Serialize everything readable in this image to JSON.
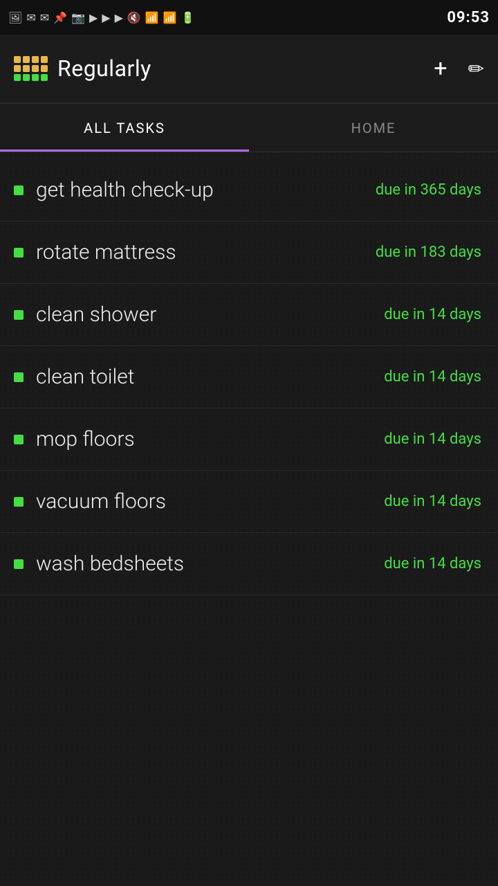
{
  "statusBar": {
    "time": "09:53",
    "icons": [
      "📷",
      "✉",
      "✉",
      "📌",
      "📷",
      "▶",
      "▶",
      "▶",
      "🔇",
      "📶",
      "📶",
      "🔋"
    ]
  },
  "appBar": {
    "title": "Regularly",
    "addButtonLabel": "+",
    "editButtonLabel": "✏"
  },
  "tabs": [
    {
      "id": "all-tasks",
      "label": "ALL TASKS",
      "active": true
    },
    {
      "id": "home",
      "label": "HOME",
      "active": false
    }
  ],
  "logoDots": [
    {
      "color": "#e8b84b"
    },
    {
      "color": "#e8b84b"
    },
    {
      "color": "#e8b84b"
    },
    {
      "color": "#e8b84b"
    },
    {
      "color": "#e8b84b"
    },
    {
      "color": "#e8b84b"
    },
    {
      "color": "#e8b84b"
    },
    {
      "color": "#e8b84b"
    },
    {
      "color": "#44dd44"
    },
    {
      "color": "#44dd44"
    },
    {
      "color": "#44dd44"
    },
    {
      "color": "#44dd44"
    }
  ],
  "tasks": [
    {
      "id": 1,
      "name": "get health check-up",
      "due": "due in 365 days"
    },
    {
      "id": 2,
      "name": "rotate mattress",
      "due": "due in 183 days"
    },
    {
      "id": 3,
      "name": "clean shower",
      "due": "due in 14 days"
    },
    {
      "id": 4,
      "name": "clean toilet",
      "due": "due in 14 days"
    },
    {
      "id": 5,
      "name": "mop floors",
      "due": "due in 14 days"
    },
    {
      "id": 6,
      "name": "vacuum floors",
      "due": "due in 14 days"
    },
    {
      "id": 7,
      "name": "wash bedsheets",
      "due": "due in 14 days"
    }
  ]
}
